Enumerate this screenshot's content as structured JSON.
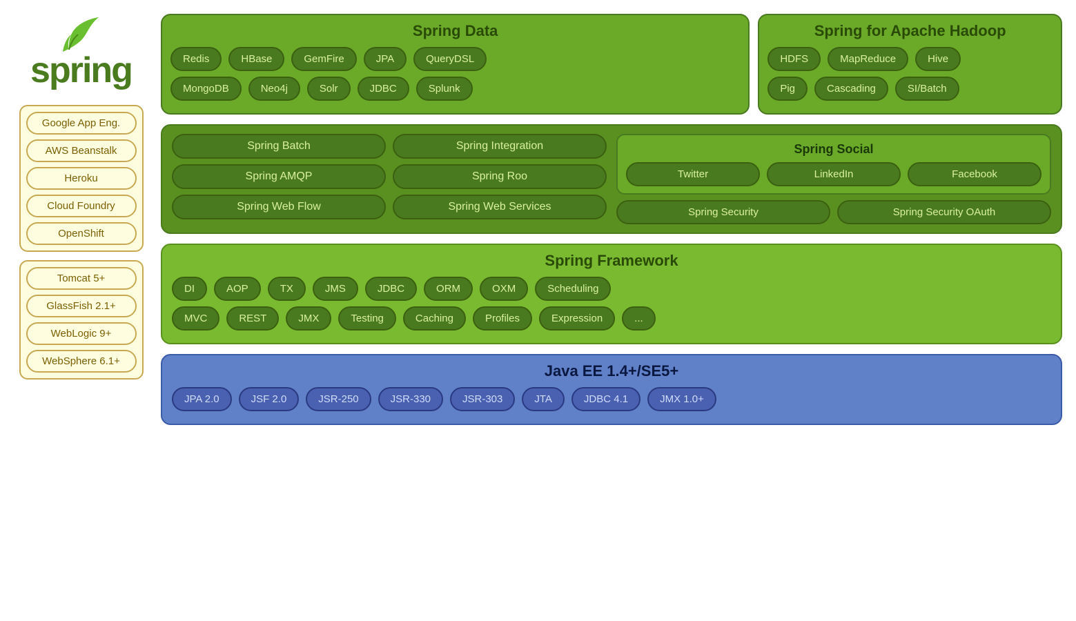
{
  "logo": {
    "text": "spring"
  },
  "left": {
    "cloud_group": [
      "Google App Eng.",
      "AWS Beanstalk",
      "Heroku",
      "Cloud Foundry",
      "OpenShift"
    ],
    "server_group": [
      "Tomcat 5+",
      "GlassFish 2.1+",
      "WebLogic 9+",
      "WebSphere 6.1+"
    ]
  },
  "spring_data": {
    "title": "Spring Data",
    "row1": [
      "Redis",
      "HBase",
      "GemFire",
      "JPA",
      "QueryDSL"
    ],
    "row2": [
      "MongoDB",
      "Neo4j",
      "Solr",
      "JDBC",
      "Splunk"
    ]
  },
  "spring_hadoop": {
    "title": "Spring for Apache Hadoop",
    "row1": [
      "HDFS",
      "MapReduce",
      "Hive"
    ],
    "row2": [
      "Pig",
      "Cascading",
      "SI/Batch"
    ]
  },
  "mid_left": {
    "items": [
      "Spring Batch",
      "Spring AMQP",
      "Spring Web Flow",
      "Spring Integration",
      "Spring Roo",
      "Spring Web Services"
    ]
  },
  "spring_social": {
    "title": "Spring Social",
    "items": [
      "Twitter",
      "LinkedIn",
      "Facebook"
    ]
  },
  "spring_security": {
    "items": [
      "Spring Security",
      "Spring Security OAuth"
    ]
  },
  "spring_framework": {
    "title": "Spring Framework",
    "row1": [
      "DI",
      "AOP",
      "TX",
      "JMS",
      "JDBC",
      "ORM",
      "OXM",
      "Scheduling"
    ],
    "row2": [
      "MVC",
      "REST",
      "JMX",
      "Testing",
      "Caching",
      "Profiles",
      "Expression",
      "..."
    ]
  },
  "java_ee": {
    "title": "Java EE 1.4+/SE5+",
    "items": [
      "JPA 2.0",
      "JSF 2.0",
      "JSR-250",
      "JSR-330",
      "JSR-303",
      "JTA",
      "JDBC 4.1",
      "JMX 1.0+"
    ]
  }
}
